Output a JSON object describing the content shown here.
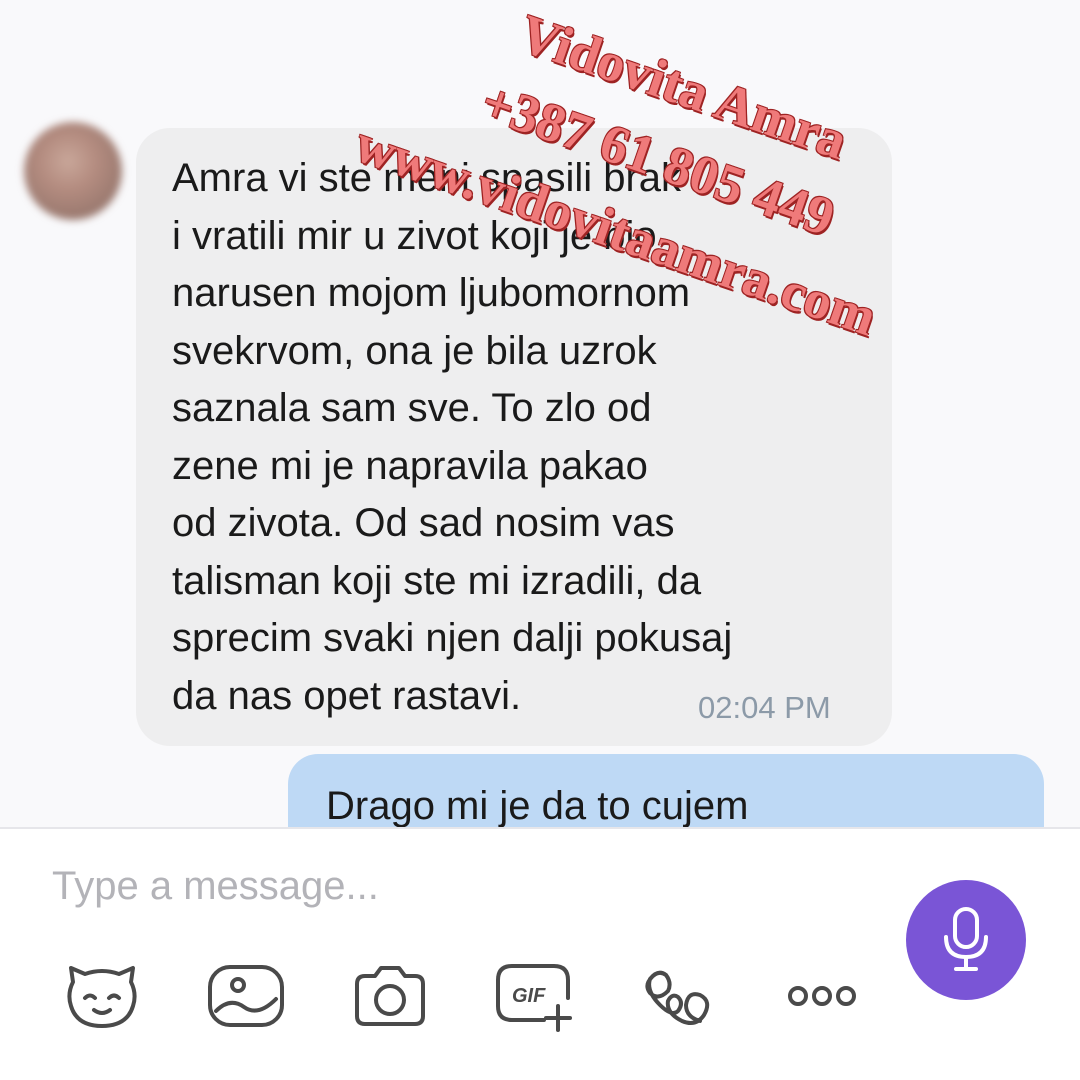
{
  "conversation": {
    "incoming": {
      "text": "Amra vi ste meni spasili brak\ni vratili mir u zivot koji je bio\nnarusen mojom ljubomornom\nsvekrvom, ona je bila uzrok\nsaznala sam sve. To zlo od\nzene mi je napravila pakao\nod zivota. Od sad nosim vas\ntalisman koji ste mi izradili, da\nsprecim svaki njen dalji pokusaj\nda nas opet rastavi.",
      "time": "02:04 PM"
    },
    "outgoing": {
      "text": "Drago mi je da to cujem"
    }
  },
  "composer": {
    "placeholder": "Type a message...",
    "value": "",
    "toolbar": [
      {
        "icon": "sticker-icon"
      },
      {
        "icon": "gallery-icon"
      },
      {
        "icon": "camera-icon"
      },
      {
        "icon": "gif-icon",
        "label": "GIF"
      },
      {
        "icon": "doodle-icon"
      },
      {
        "icon": "more-icon"
      }
    ],
    "mic_icon": "microphone-icon"
  },
  "watermark": {
    "line1": "Vidovita Amra",
    "line2": "+387 61 805 449",
    "line3": "www.vidovitaamra.com"
  },
  "colors": {
    "incoming_bubble": "#eeeeef",
    "outgoing_bubble": "#bed9f5",
    "accent_purple": "#7a55d6",
    "timestamp": "#8c9aa8",
    "watermark": "#ef7a7a"
  }
}
